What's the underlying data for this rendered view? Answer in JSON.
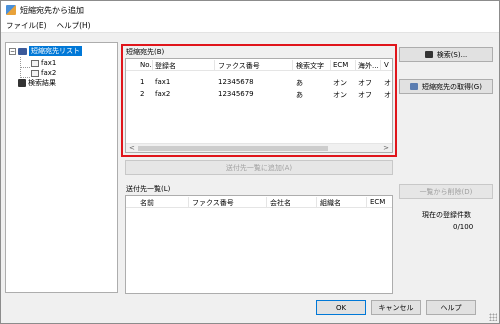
{
  "window": {
    "title": "短縮宛先から追加"
  },
  "menu": [
    {
      "label": "ファイル(E)"
    },
    {
      "label": "ヘルプ(H)"
    }
  ],
  "tree": {
    "root": "短縮宛先リスト",
    "children": [
      "fax1",
      "fax2"
    ],
    "search_results": "検索結果",
    "toggle": "−"
  },
  "speed_dial": {
    "label": "短縮宛先(B)",
    "columns": [
      "No.",
      "登録名",
      "ファクス番号",
      "検索文字",
      "ECM",
      "海外...",
      "V"
    ],
    "rows": [
      {
        "no": "1",
        "name": "fax1",
        "number": "12345678",
        "search": "あ",
        "ecm": "オン",
        "overseas": "オフ",
        "v": "オ"
      },
      {
        "no": "2",
        "name": "fax2",
        "number": "12345679",
        "search": "あ",
        "ecm": "オン",
        "overseas": "オフ",
        "v": "オ"
      }
    ]
  },
  "dest_list": {
    "label": "送付先一覧(L)",
    "columns": [
      "名前",
      "ファクス番号",
      "会社名",
      "組織名",
      "ECM"
    ]
  },
  "buttons": {
    "search": "検索(S)...",
    "get_speed_dial": "短縮宛先の取得(G)",
    "add_to_list": "送付先一覧に追加(A)",
    "remove_from_list": "一覧から削除(D)",
    "ok": "OK",
    "cancel": "キャンセル",
    "help": "ヘルプ"
  },
  "registered": {
    "label": "現在の登録件数",
    "count": "0/100"
  },
  "scroll_arrows": {
    "left": "<",
    "right": ">"
  }
}
